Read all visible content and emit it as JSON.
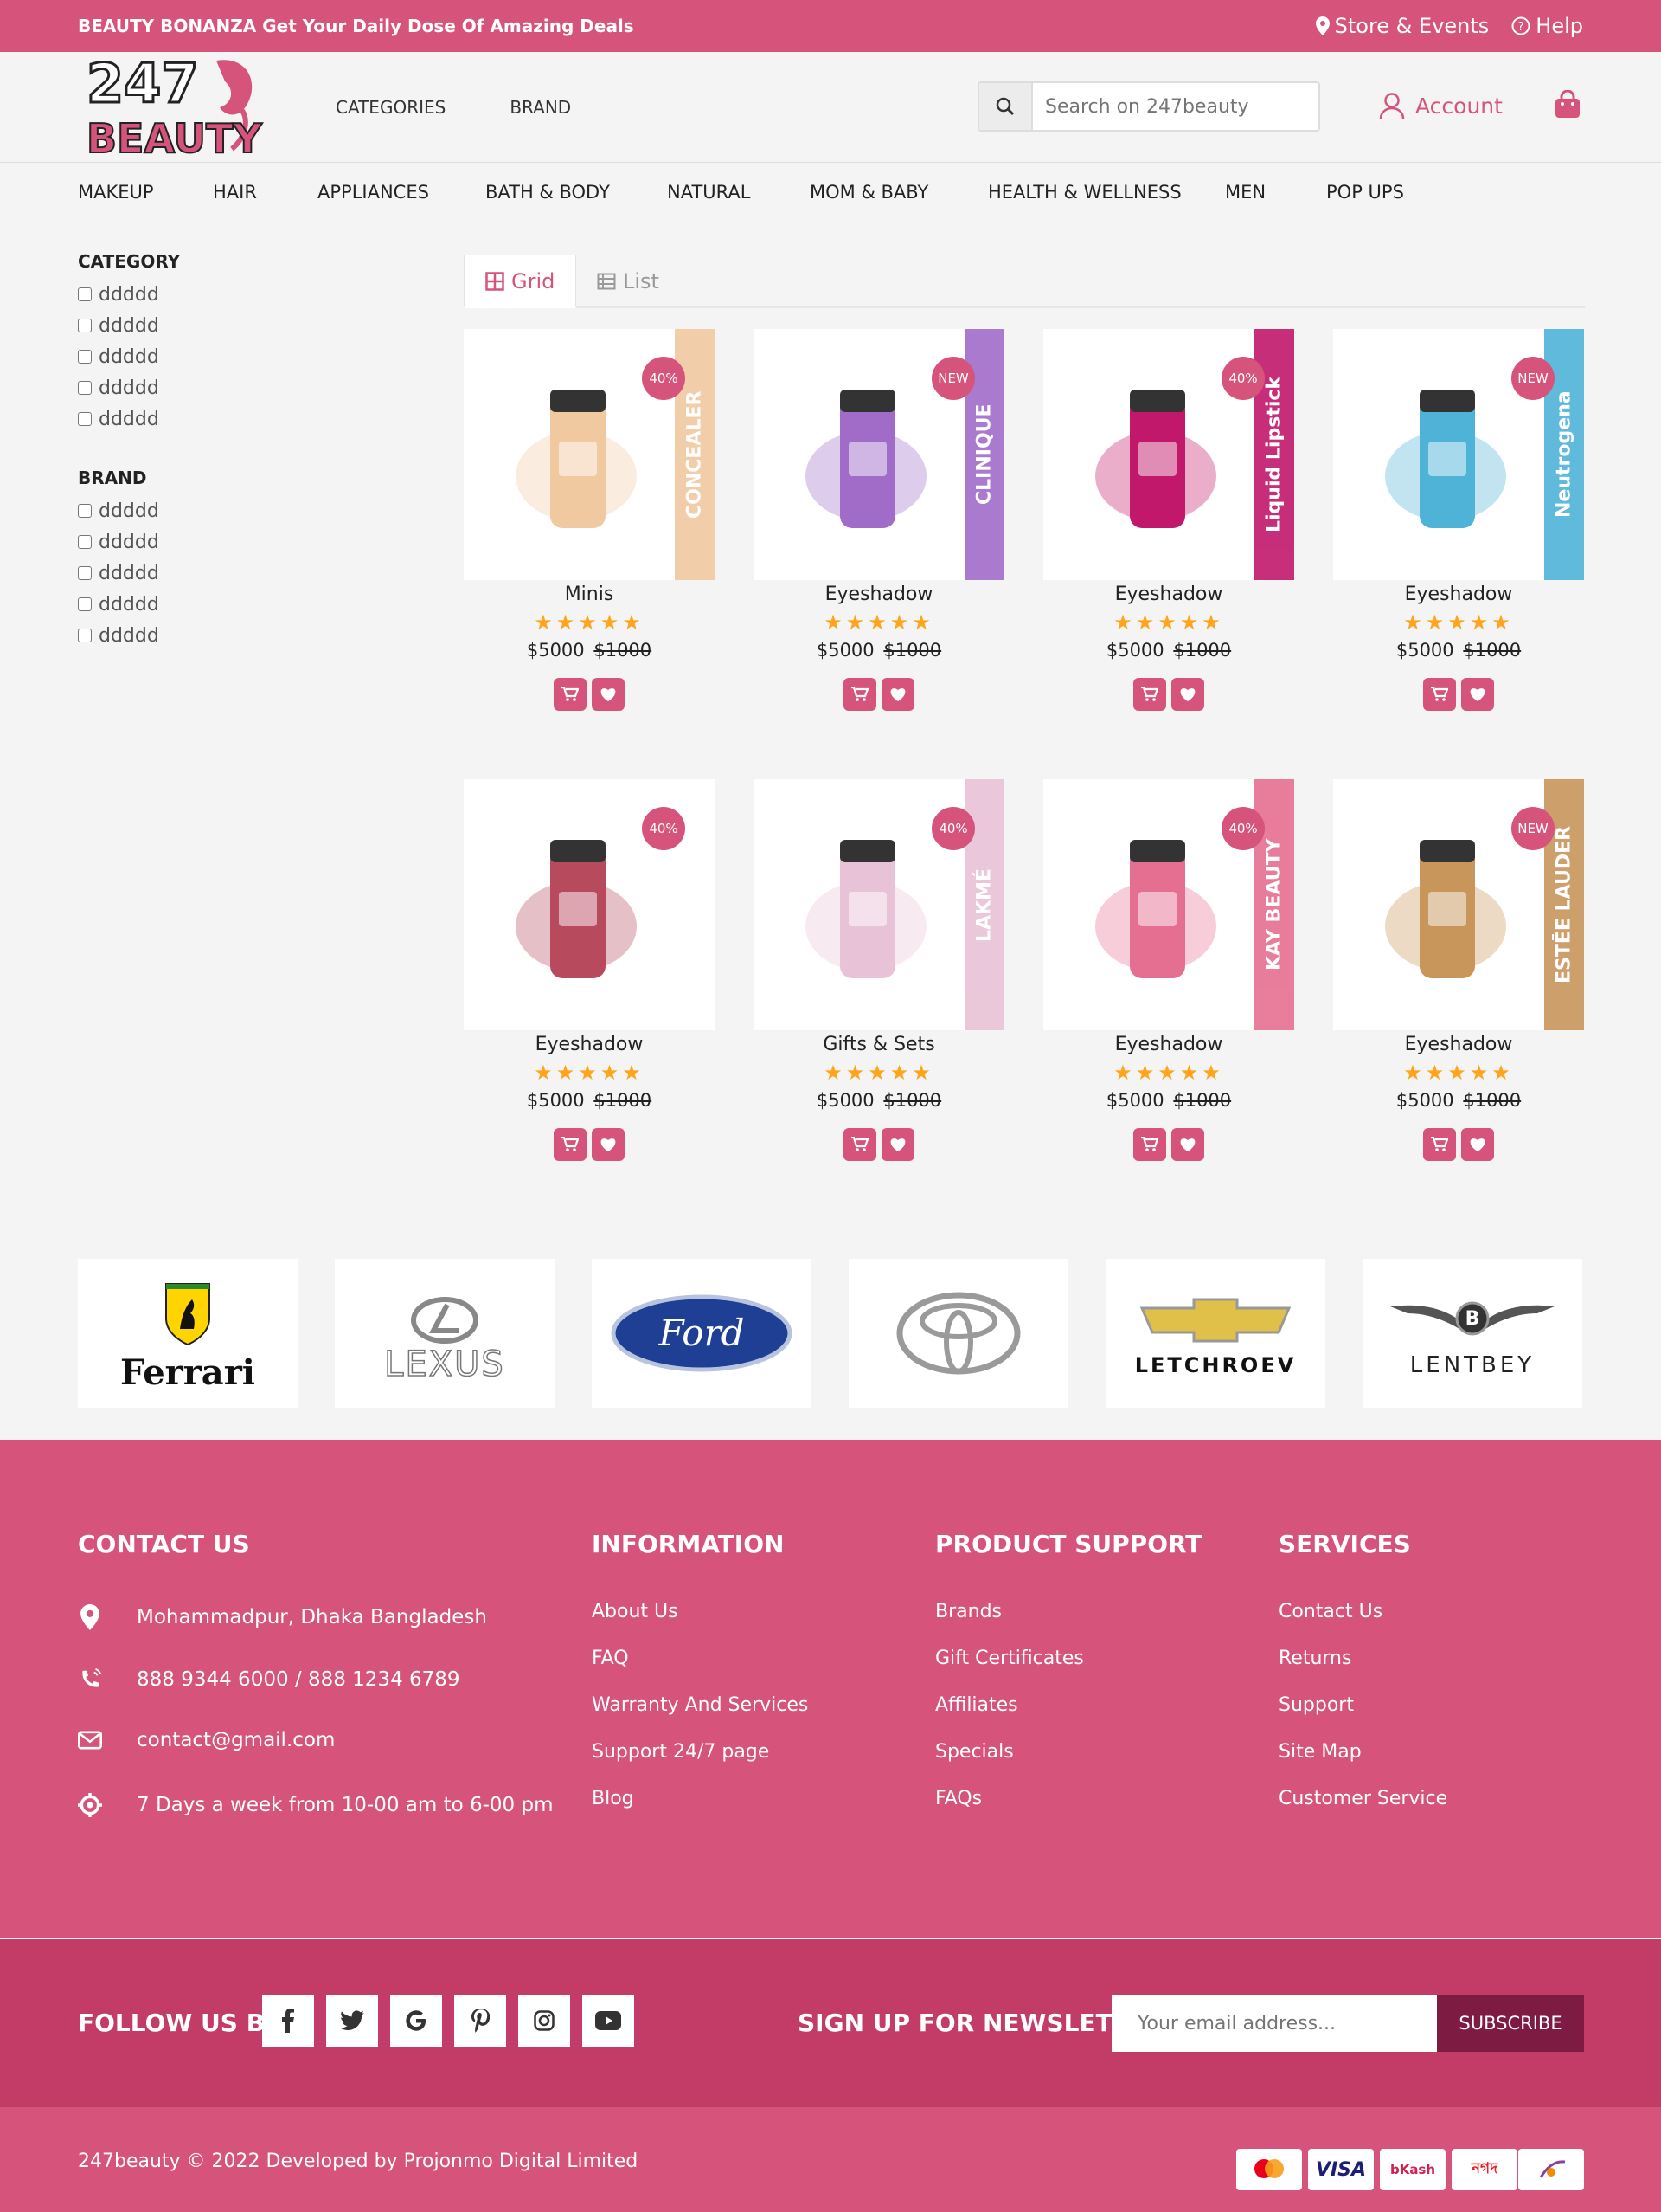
{
  "topbar": {
    "promo": "BEAUTY BONANZA Get Your Daily Dose Of Amazing Deals",
    "store": "Store & Events",
    "help": "Help"
  },
  "header": {
    "logo_top": "247",
    "logo_bottom": "BEAUTY",
    "nav": [
      "CATEGORIES",
      "BRAND"
    ],
    "search_placeholder": "Search on 247beauty",
    "account": "Account"
  },
  "categories": [
    "MAKEUP",
    "HAIR",
    "APPLIANCES",
    "BATH & BODY",
    "NATURAL",
    "MOM & BABY",
    "HEALTH & WELLNESS",
    "MEN",
    "POP UPS"
  ],
  "sidebar": {
    "category_title": "CATEGORY",
    "category_items": [
      "ddddd",
      "ddddd",
      "ddddd",
      "ddddd",
      "ddddd"
    ],
    "brand_title": "BRAND",
    "brand_items": [
      "ddddd",
      "ddddd",
      "ddddd",
      "ddddd",
      "ddddd"
    ]
  },
  "view_tabs": {
    "grid": "Grid",
    "list": "List"
  },
  "products": [
    {
      "name": "Minis",
      "badge": "40%",
      "price": "$5000",
      "old_price": "$1000",
      "rating": 5,
      "color": "#f0c9a0",
      "side_text": "CONCEALER"
    },
    {
      "name": "Eyeshadow",
      "badge": "NEW",
      "price": "$5000",
      "old_price": "$1000",
      "rating": 5,
      "color": "#a06cc8",
      "side_text": "CLINIQUE"
    },
    {
      "name": "Eyeshadow",
      "badge": "40%",
      "price": "$5000",
      "old_price": "$1000",
      "rating": 5,
      "color": "#c2186b",
      "side_text": "Liquid Lipstick"
    },
    {
      "name": "Eyeshadow",
      "badge": "NEW",
      "price": "$5000",
      "old_price": "$1000",
      "rating": 5,
      "color": "#4fb3d8",
      "side_text": "Neutrogena"
    },
    {
      "name": "Eyeshadow",
      "badge": "40%",
      "price": "$5000",
      "old_price": "$1000",
      "rating": 5,
      "color": "#b84a5e",
      "side_text": ""
    },
    {
      "name": "Gifts & Sets",
      "badge": "40%",
      "price": "$5000",
      "old_price": "$1000",
      "rating": 5,
      "color": "#e8c2d6",
      "side_text": "LAKMÉ"
    },
    {
      "name": "Eyeshadow",
      "badge": "40%",
      "price": "$5000",
      "old_price": "$1000",
      "rating": 5,
      "color": "#e56f91",
      "side_text": "KAY BEAUTY"
    },
    {
      "name": "Eyeshadow",
      "badge": "NEW",
      "price": "$5000",
      "old_price": "$1000",
      "rating": 5,
      "color": "#c8955a",
      "side_text": "ESTĒE LAUDER"
    }
  ],
  "brands": [
    "Ferrari",
    "LEXUS",
    "Ford",
    "",
    "LETCHROEV",
    "LENTBEY"
  ],
  "footer": {
    "contact_title": "CONTACT US",
    "contact": [
      {
        "icon": "location-icon",
        "text": "Mohammadpur, Dhaka Bangladesh"
      },
      {
        "icon": "phone-icon",
        "text": "888 9344 6000 / 888 1234 6789"
      },
      {
        "icon": "mail-icon",
        "text": "contact@gmail.com"
      },
      {
        "icon": "clock-icon",
        "text": "7 Days a week from 10-00 am to 6-00 pm"
      }
    ],
    "info_title": "INFORMATION",
    "info_links": [
      "About Us",
      "FAQ",
      "Warranty And Services",
      "Support 24/7 page",
      "Blog"
    ],
    "support_title": "PRODUCT SUPPORT",
    "support_links": [
      "Brands",
      "Gift Certificates",
      "Affiliates",
      "Specials",
      "FAQs"
    ],
    "services_title": "SERVICES",
    "services_links": [
      "Contact Us",
      "Returns",
      "Support",
      "Site Map",
      "Customer Service"
    ]
  },
  "follow": {
    "label": "FOLLOW US BY",
    "icons": [
      "facebook-icon",
      "twitter-icon",
      "google-icon",
      "pinterest-icon",
      "instagram-icon",
      "youtube-icon"
    ],
    "newsletter_label": "SIGN UP FOR NEWSLETTER",
    "email_placeholder": "Your email address...",
    "subscribe": "SUBSCRIBE"
  },
  "bottom": {
    "copyright": "247beauty © 2022 Developed by Projonmo Digital Limited",
    "payments": [
      "mastercard",
      "VISA",
      "bKash",
      "নগদ",
      "rocket"
    ]
  },
  "colors": {
    "brand": "#d6547c",
    "dark": "#c33c68",
    "button": "#7e1b43",
    "star": "#ffa41b"
  }
}
